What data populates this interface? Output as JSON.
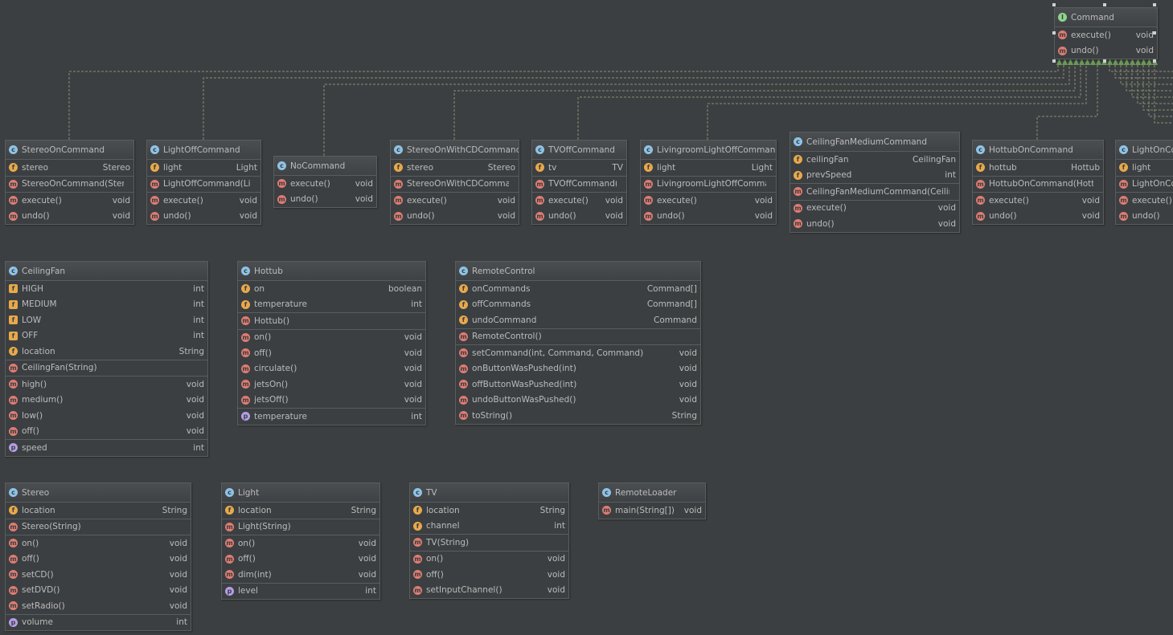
{
  "classes": [
    {
      "name": "Command",
      "kind": "i",
      "sections": [
        [
          {
            "icon": "m",
            "name": "execute()",
            "type": "void"
          },
          {
            "icon": "m",
            "name": "undo()",
            "type": "void"
          }
        ]
      ]
    },
    {
      "name": "StereoOnCommand",
      "kind": "c",
      "sections": [
        [
          {
            "icon": "f",
            "name": "stereo",
            "type": "Stereo"
          }
        ],
        [
          {
            "icon": "m",
            "name": "StereoOnCommand(Stereo)",
            "type": ""
          }
        ],
        [
          {
            "icon": "m",
            "name": "execute()",
            "type": "void"
          },
          {
            "icon": "m",
            "name": "undo()",
            "type": "void"
          }
        ]
      ]
    },
    {
      "name": "LightOffCommand",
      "kind": "c",
      "sections": [
        [
          {
            "icon": "f",
            "name": "light",
            "type": "Light"
          }
        ],
        [
          {
            "icon": "m",
            "name": "LightOffCommand(Light)",
            "type": ""
          }
        ],
        [
          {
            "icon": "m",
            "name": "execute()",
            "type": "void"
          },
          {
            "icon": "m",
            "name": "undo()",
            "type": "void"
          }
        ]
      ]
    },
    {
      "name": "NoCommand",
      "kind": "c",
      "sections": [
        [
          {
            "icon": "m",
            "name": "execute()",
            "type": "void"
          },
          {
            "icon": "m",
            "name": "undo()",
            "type": "void"
          }
        ]
      ]
    },
    {
      "name": "StereoOnWithCDCommand",
      "kind": "c",
      "sections": [
        [
          {
            "icon": "f",
            "name": "stereo",
            "type": "Stereo"
          }
        ],
        [
          {
            "icon": "m",
            "name": "StereoOnWithCDCommand(S",
            "type": ""
          }
        ],
        [
          {
            "icon": "m",
            "name": "execute()",
            "type": "void"
          },
          {
            "icon": "m",
            "name": "undo()",
            "type": "void"
          }
        ]
      ]
    },
    {
      "name": "TVOffCommand",
      "kind": "c",
      "sections": [
        [
          {
            "icon": "f",
            "name": "tv",
            "type": "TV"
          }
        ],
        [
          {
            "icon": "m",
            "name": "TVOffCommand(TV)",
            "type": ""
          }
        ],
        [
          {
            "icon": "m",
            "name": "execute()",
            "type": "void"
          },
          {
            "icon": "m",
            "name": "undo()",
            "type": "void"
          }
        ]
      ]
    },
    {
      "name": "LivingroomLightOffCommand",
      "kind": "c",
      "sections": [
        [
          {
            "icon": "f",
            "name": "light",
            "type": "Light"
          }
        ],
        [
          {
            "icon": "m",
            "name": "LivingroomLightOffCommand(L",
            "type": ""
          }
        ],
        [
          {
            "icon": "m",
            "name": "execute()",
            "type": "void"
          },
          {
            "icon": "m",
            "name": "undo()",
            "type": "void"
          }
        ]
      ]
    },
    {
      "name": "CeilingFanMediumCommand",
      "kind": "c",
      "sections": [
        [
          {
            "icon": "f",
            "name": "ceilingFan",
            "type": "CeilingFan"
          },
          {
            "icon": "f",
            "name": "prevSpeed",
            "type": "int"
          }
        ],
        [
          {
            "icon": "m",
            "name": "CeilingFanMediumCommand(CeilingFar",
            "type": ""
          }
        ],
        [
          {
            "icon": "m",
            "name": "execute()",
            "type": "void"
          },
          {
            "icon": "m",
            "name": "undo()",
            "type": "void"
          }
        ]
      ]
    },
    {
      "name": "HottubOnCommand",
      "kind": "c",
      "sections": [
        [
          {
            "icon": "f",
            "name": "hottub",
            "type": "Hottub"
          }
        ],
        [
          {
            "icon": "m",
            "name": "HottubOnCommand(Hottub)",
            "type": ""
          }
        ],
        [
          {
            "icon": "m",
            "name": "execute()",
            "type": "void"
          },
          {
            "icon": "m",
            "name": "undo()",
            "type": "void"
          }
        ]
      ]
    },
    {
      "name": "LightOnCo",
      "kind": "c",
      "sections": [
        [
          {
            "icon": "f",
            "name": "light",
            "type": ""
          }
        ],
        [
          {
            "icon": "m",
            "name": "LightOnCo",
            "type": ""
          }
        ],
        [
          {
            "icon": "m",
            "name": "execute()",
            "type": ""
          },
          {
            "icon": "m",
            "name": "undo()",
            "type": ""
          }
        ]
      ]
    },
    {
      "name": "CeilingFan",
      "kind": "c",
      "sections": [
        [
          {
            "icon": "s",
            "name": "HIGH",
            "type": "int"
          },
          {
            "icon": "s",
            "name": "MEDIUM",
            "type": "int"
          },
          {
            "icon": "s",
            "name": "LOW",
            "type": "int"
          },
          {
            "icon": "s",
            "name": "OFF",
            "type": "int"
          },
          {
            "icon": "f",
            "name": "location",
            "type": "String"
          }
        ],
        [
          {
            "icon": "m",
            "name": "CeilingFan(String)",
            "type": ""
          }
        ],
        [
          {
            "icon": "m",
            "name": "high()",
            "type": "void"
          },
          {
            "icon": "m",
            "name": "medium()",
            "type": "void"
          },
          {
            "icon": "m",
            "name": "low()",
            "type": "void"
          },
          {
            "icon": "m",
            "name": "off()",
            "type": "void"
          }
        ],
        [
          {
            "icon": "p",
            "name": "speed",
            "type": "int"
          }
        ]
      ]
    },
    {
      "name": "Hottub",
      "kind": "c",
      "sections": [
        [
          {
            "icon": "f",
            "name": "on",
            "type": "boolean"
          },
          {
            "icon": "f",
            "name": "temperature",
            "type": "int"
          }
        ],
        [
          {
            "icon": "m",
            "name": "Hottub()",
            "type": ""
          }
        ],
        [
          {
            "icon": "m",
            "name": "on()",
            "type": "void"
          },
          {
            "icon": "m",
            "name": "off()",
            "type": "void"
          },
          {
            "icon": "m",
            "name": "circulate()",
            "type": "void"
          },
          {
            "icon": "m",
            "name": "jetsOn()",
            "type": "void"
          },
          {
            "icon": "m",
            "name": "jetsOff()",
            "type": "void"
          }
        ],
        [
          {
            "icon": "p",
            "name": "temperature",
            "type": "int"
          }
        ]
      ]
    },
    {
      "name": "RemoteControl",
      "kind": "c",
      "sections": [
        [
          {
            "icon": "f",
            "name": "onCommands",
            "type": "Command[]"
          },
          {
            "icon": "f",
            "name": "offCommands",
            "type": "Command[]"
          },
          {
            "icon": "f",
            "name": "undoCommand",
            "type": "Command"
          }
        ],
        [
          {
            "icon": "m",
            "name": "RemoteControl()",
            "type": ""
          }
        ],
        [
          {
            "icon": "m",
            "name": "setCommand(int, Command, Command)",
            "type": "void"
          },
          {
            "icon": "m",
            "name": "onButtonWasPushed(int)",
            "type": "void"
          },
          {
            "icon": "m",
            "name": "offButtonWasPushed(int)",
            "type": "void"
          },
          {
            "icon": "m",
            "name": "undoButtonWasPushed()",
            "type": "void"
          },
          {
            "icon": "m",
            "name": "toString()",
            "type": "String"
          }
        ]
      ]
    },
    {
      "name": "Stereo",
      "kind": "c",
      "sections": [
        [
          {
            "icon": "f",
            "name": "location",
            "type": "String"
          }
        ],
        [
          {
            "icon": "m",
            "name": "Stereo(String)",
            "type": ""
          }
        ],
        [
          {
            "icon": "m",
            "name": "on()",
            "type": "void"
          },
          {
            "icon": "m",
            "name": "off()",
            "type": "void"
          },
          {
            "icon": "m",
            "name": "setCD()",
            "type": "void"
          },
          {
            "icon": "m",
            "name": "setDVD()",
            "type": "void"
          },
          {
            "icon": "m",
            "name": "setRadio()",
            "type": "void"
          }
        ],
        [
          {
            "icon": "p",
            "name": "volume",
            "type": "int"
          }
        ]
      ]
    },
    {
      "name": "Light",
      "kind": "c",
      "sections": [
        [
          {
            "icon": "f",
            "name": "location",
            "type": "String"
          }
        ],
        [
          {
            "icon": "m",
            "name": "Light(String)",
            "type": ""
          }
        ],
        [
          {
            "icon": "m",
            "name": "on()",
            "type": "void"
          },
          {
            "icon": "m",
            "name": "off()",
            "type": "void"
          },
          {
            "icon": "m",
            "name": "dim(int)",
            "type": "void"
          }
        ],
        [
          {
            "icon": "p",
            "name": "level",
            "type": "int"
          }
        ]
      ]
    },
    {
      "name": "TV",
      "kind": "c",
      "sections": [
        [
          {
            "icon": "f",
            "name": "location",
            "type": "String"
          },
          {
            "icon": "f",
            "name": "channel",
            "type": "int"
          }
        ],
        [
          {
            "icon": "m",
            "name": "TV(String)",
            "type": ""
          }
        ],
        [
          {
            "icon": "m",
            "name": "on()",
            "type": "void"
          },
          {
            "icon": "m",
            "name": "off()",
            "type": "void"
          },
          {
            "icon": "m",
            "name": "setInputChannel()",
            "type": "void"
          }
        ]
      ]
    },
    {
      "name": "RemoteLoader",
      "kind": "c",
      "sections": [
        [
          {
            "icon": "m",
            "name": "main(String[])",
            "type": "void"
          }
        ]
      ]
    }
  ],
  "colors": {
    "background": "#3c3f41",
    "realization_arrow": "#6a9955",
    "dashed_line": "#8a8f73"
  }
}
